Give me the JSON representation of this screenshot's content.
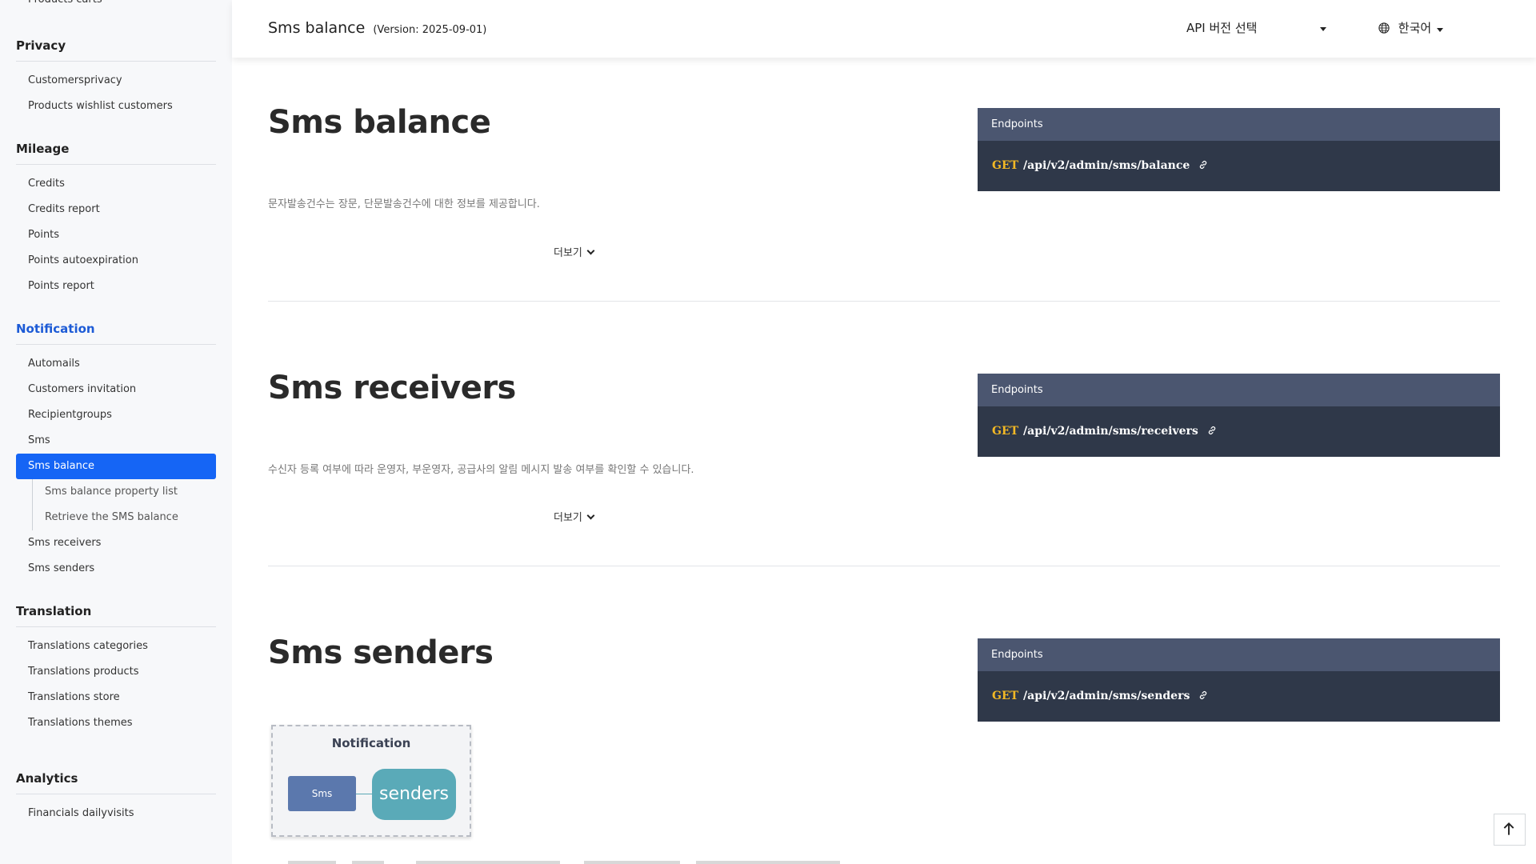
{
  "sidebar": {
    "partial_top_item": "Products carts",
    "groups": [
      {
        "title": "Privacy",
        "items": [
          "Customersprivacy",
          "Products wishlist customers"
        ]
      },
      {
        "title": "Mileage",
        "items": [
          "Credits",
          "Credits report",
          "Points",
          "Points autoexpiration",
          "Points report"
        ]
      },
      {
        "title": "Notification",
        "items": [
          "Automails",
          "Customers invitation",
          "Recipientgroups",
          "Sms",
          "Sms balance",
          "Sms receivers",
          "Sms senders"
        ]
      },
      {
        "title": "Translation",
        "items": [
          "Translations categories",
          "Translations products",
          "Translations store",
          "Translations themes"
        ]
      },
      {
        "title": "Analytics",
        "items": [
          "Financials dailyvisits"
        ]
      }
    ],
    "selected_item": "Sms balance",
    "selected_subitems": [
      "Sms balance property list",
      "Retrieve the SMS balance"
    ]
  },
  "header": {
    "title": "Sms balance",
    "version": "(Version: 2025-09-01)",
    "api_select_label": "API 버전 선택",
    "lang_label": "한국어"
  },
  "sections": [
    {
      "title": "Sms balance",
      "desc": "문자발송건수는 장문, 단문발송건수에 대한 정보를 제공합니다.",
      "more": "더보기",
      "endpoint_header": "Endpoints",
      "method": "GET",
      "path": "/api/v2/admin/sms/balance"
    },
    {
      "title": "Sms receivers",
      "desc": "수신자 등록 여부에 따라 운영자, 부운영자, 공급사의 알림 메시지 발송 여부를 확인할 수 있습니다.",
      "more": "더보기",
      "endpoint_header": "Endpoints",
      "method": "GET",
      "path": "/api/v2/admin/sms/receivers"
    },
    {
      "title": "Sms senders",
      "endpoint_header": "Endpoints",
      "method": "GET",
      "path": "/api/v2/admin/sms/senders",
      "diagram": {
        "title": "Notification",
        "left_box": "Sms",
        "right_box": "senders"
      }
    }
  ],
  "colors": {
    "accent": "#1565f5",
    "endpoint_bg": "#2f3849",
    "endpoint_head": "#4b5670",
    "method": "#f2b825"
  },
  "icons": {
    "link": "link-icon",
    "globe": "globe-icon",
    "to_top": "arrow-up-icon"
  }
}
